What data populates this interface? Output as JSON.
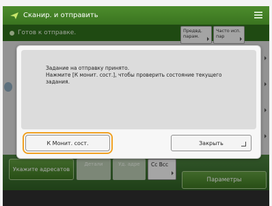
{
  "header": {
    "title": "Сканир. и отправить",
    "status": "Готов к отправке."
  },
  "shortcuts": [
    {
      "label": "Предвд. парам."
    },
    {
      "label": "Часто исп. пар"
    }
  ],
  "bottom": {
    "specify_label": "Укажите адресатов",
    "disabled": [
      {
        "label": "Детали"
      },
      {
        "label": "Уд. адре"
      }
    ],
    "cc_label": "Cc Bcc",
    "params_label": "Параметры"
  },
  "dialog": {
    "message": "Задание на отправку принято.\nНажмите [К монит. сост.], чтобы проверить состояние текущего задания.",
    "monitor_label": "К Монит. сост.",
    "close_label": "Закрыть"
  },
  "colors": {
    "header_green": "#3a7420",
    "accent_orange": "#f0a020"
  }
}
